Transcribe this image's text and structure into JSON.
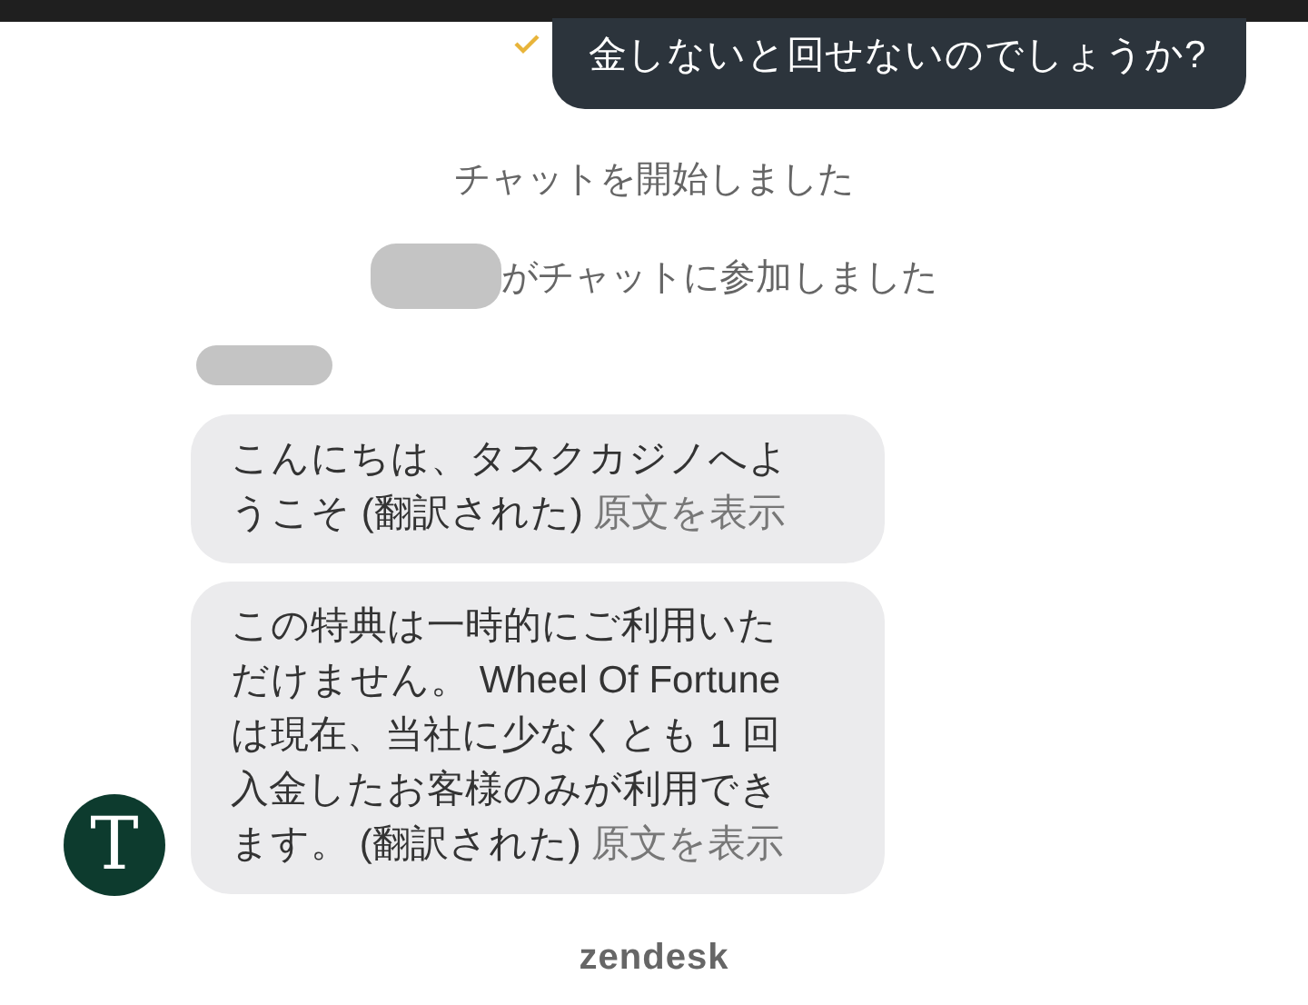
{
  "sent_message": {
    "text": "金しないと回せないのでしょうか?",
    "delivered": true
  },
  "system_messages": [
    {
      "text": "チャットを開始しました",
      "redacted_name": false
    },
    {
      "text": "がチャットに参加しました",
      "redacted_name": true
    }
  ],
  "agent": {
    "avatar_letter": "T",
    "name_redacted": true
  },
  "agent_messages": [
    {
      "text": "こんにちは、タスクカジノへようこそ (翻訳された)",
      "link": "原文を表示"
    },
    {
      "text": "この特典は一時的にご利用いただけません。 Wheel Of Fortune は現在、当社に少なくとも 1 回入金したお客様のみが利用できます。 (翻訳された)",
      "link": "原文を表示"
    }
  ],
  "footer": {
    "brand": "zendesk"
  }
}
